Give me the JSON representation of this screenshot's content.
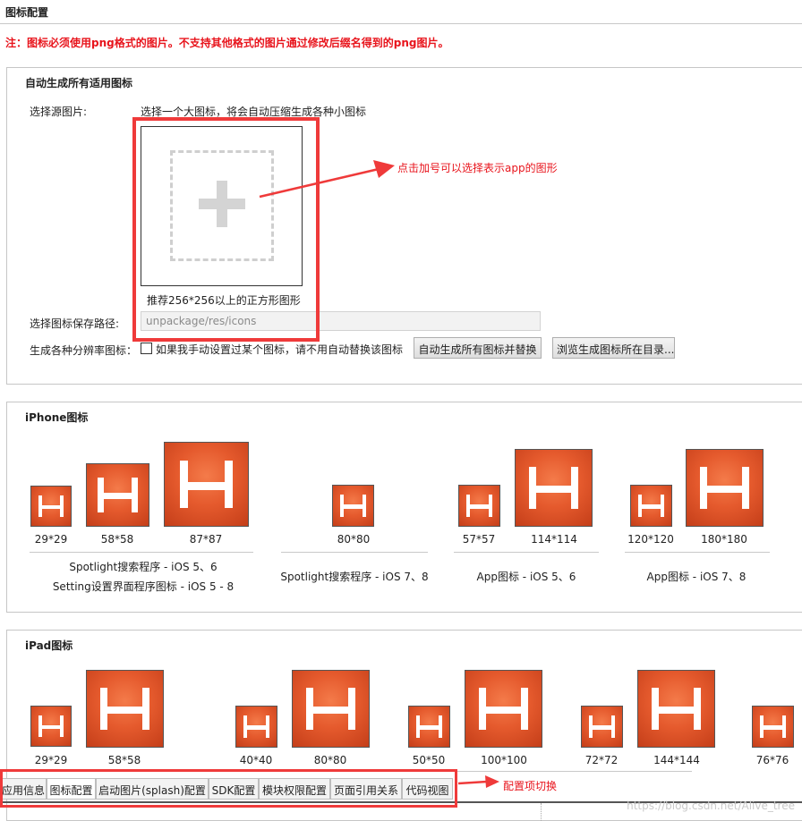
{
  "page": {
    "title": "图标配置",
    "warning": "注：图标必须使用png格式的图片。不支持其他格式的图片通过修改后缀名得到的png图片。"
  },
  "auto_section": {
    "title": "自动生成所有适用图标",
    "source_label": "选择源图片:",
    "source_hint": "选择一个大图标，将会自动压缩生成各种小图标",
    "picker_caption": "推荐256*256以上的正方形图形",
    "path_label": "选择图标保存路径:",
    "path_value": "unpackage/res/icons",
    "resolutions_label": "生成各种分辨率图标：",
    "overwrite_checkbox_label": "如果我手动设置过某个图标，请不用自动替换该图标",
    "overwrite_checked": false,
    "generate_button": "自动生成所有图标并替换",
    "browse_button": "浏览生成图标所在目录..."
  },
  "annotations": {
    "picker_note": "点击加号可以选择表示app的图形",
    "tabs_note": "配置项切换",
    "color": "#e8141c"
  },
  "iphone_section": {
    "title": "iPhone图标",
    "groups": [
      {
        "caption_lines": [
          "Spotlight搜索程序 - iOS 5、6",
          "Setting设置界面程序图标 - iOS 5 - 8"
        ],
        "icons": [
          "29*29",
          "58*58",
          "87*87"
        ]
      },
      {
        "caption_lines": [
          "Spotlight搜索程序 - iOS 7、8"
        ],
        "icons": [
          "80*80"
        ]
      },
      {
        "caption_lines": [
          "App图标 - iOS 5、6"
        ],
        "icons": [
          "57*57",
          "114*114"
        ]
      },
      {
        "caption_lines": [
          "App图标 - iOS 7、8"
        ],
        "icons": [
          "120*120",
          "180*180"
        ]
      }
    ]
  },
  "ipad_section": {
    "title": "iPad图标",
    "icons": [
      "29*29",
      "58*58",
      "40*40",
      "80*80",
      "50*50",
      "100*100",
      "72*72",
      "144*144",
      "76*76"
    ]
  },
  "tabs": [
    {
      "label": "应用信息",
      "active": false
    },
    {
      "label": "图标配置",
      "active": true
    },
    {
      "label": "启动图片(splash)配置",
      "active": false
    },
    {
      "label": "SDK配置",
      "active": false
    },
    {
      "label": "模块权限配置",
      "active": false
    },
    {
      "label": "页面引用关系",
      "active": false
    },
    {
      "label": "代码视图",
      "active": false
    }
  ],
  "watermark": "https://blog.csdn.net/Alive_tree",
  "colors": {
    "icon_orange": "#e55a2d",
    "highlight_red": "#ef3a3a"
  }
}
